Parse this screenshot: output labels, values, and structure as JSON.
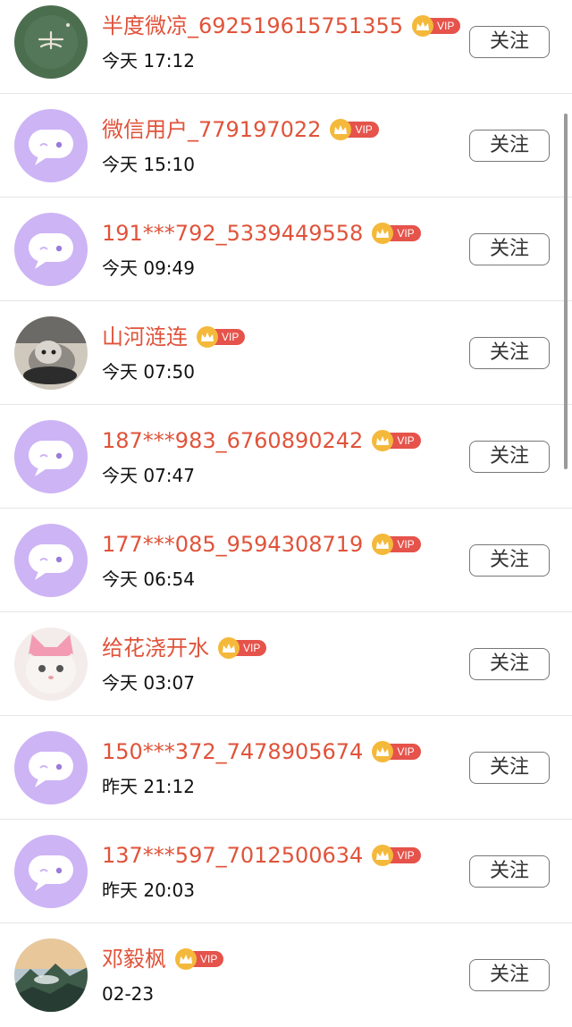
{
  "follow_label": "关注",
  "vip_label": "VIP",
  "colors": {
    "name": "#e0533a",
    "vip_tag": "#e5534b",
    "crown": "#f4b93b",
    "default_avatar": "#cdb4f5"
  },
  "rows": [
    {
      "name": "半度微凉_692519615751355",
      "time": "今天 17:12",
      "avatar": "green-calligraphy"
    },
    {
      "name": "微信用户_779197022",
      "time": "今天 15:10",
      "avatar": "default"
    },
    {
      "name": "191***792_5339449558",
      "time": "今天 09:49",
      "avatar": "default"
    },
    {
      "name": "山河涟连",
      "time": "今天 07:50",
      "avatar": "cat-photo"
    },
    {
      "name": "187***983_6760890242",
      "time": "今天 07:47",
      "avatar": "default"
    },
    {
      "name": "177***085_9594308719",
      "time": "今天 06:54",
      "avatar": "default"
    },
    {
      "name": "给花浇开水",
      "time": "今天 03:07",
      "avatar": "pink-cat-photo"
    },
    {
      "name": "150***372_7478905674",
      "time": "昨天 21:12",
      "avatar": "default"
    },
    {
      "name": "137***597_7012500634",
      "time": "昨天 20:03",
      "avatar": "default"
    },
    {
      "name": "邓毅枫",
      "time": "02-23",
      "avatar": "landscape-photo"
    }
  ]
}
